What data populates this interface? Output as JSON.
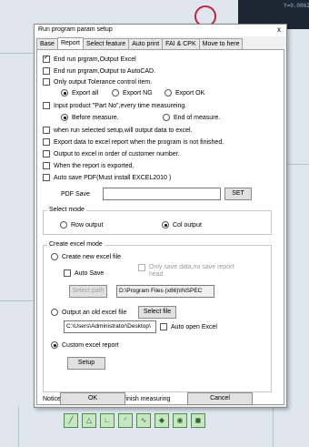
{
  "background": {
    "coord_text": "Y=0.0862"
  },
  "dialog": {
    "title": "Run program param setup",
    "close_label": "x",
    "tabs": [
      "Base",
      "Report",
      "Select feature",
      "Auto print",
      "FAI & CPK",
      "Move to here"
    ],
    "active_tab": "Report",
    "options": {
      "end_run_excel": "End run prgram,Output Excel",
      "end_run_autocad": "End run prgram,Output to AutoCAD.",
      "only_tolerance": "Only output Tolerance control item.",
      "export_all": "Export all",
      "export_ng": "Export NG",
      "export_ok": "Export OK",
      "input_partno": "Input product \"Part No\",every time measureing.",
      "before_measure": "Before measure.",
      "end_of_measure": "End of measure.",
      "when_run_selected": "when run selected setup,will output data to excel.",
      "export_not_finished": "Export data to excel report when the program is not finished.",
      "output_in_order": "Output to excel in order of customer number.",
      "when_exported": "When the report is exported,",
      "auto_save_pdf": "Auto save  PDF(Must install EXCEL2010 )",
      "pdf_save_label": "PDF Save",
      "pdf_save_value": "",
      "set_button": "SET"
    },
    "select_mode": {
      "title": "Select mode",
      "row_output": "Row output",
      "col_output": "Col output"
    },
    "create_excel": {
      "title": "Create excel mode",
      "create_new": "Create new excel file",
      "auto_save": "Auto Save",
      "only_save_data": "Only save data,no save report head",
      "select_path_button": "Select path",
      "path_value": "D:\\Program Files (x86)\\INSPEC",
      "output_old": "Output an old excel file",
      "select_file_button": "Select file",
      "file_value": "C:\\Users\\Administrator\\Desktop\\",
      "auto_open_excel": "Auto open Excel",
      "custom_report": "Custom excel report",
      "setup_button": "Setup"
    },
    "notice": "Notice:Will show report after finish measuring",
    "ok_button": "OK",
    "cancel_button": "Cancel"
  }
}
